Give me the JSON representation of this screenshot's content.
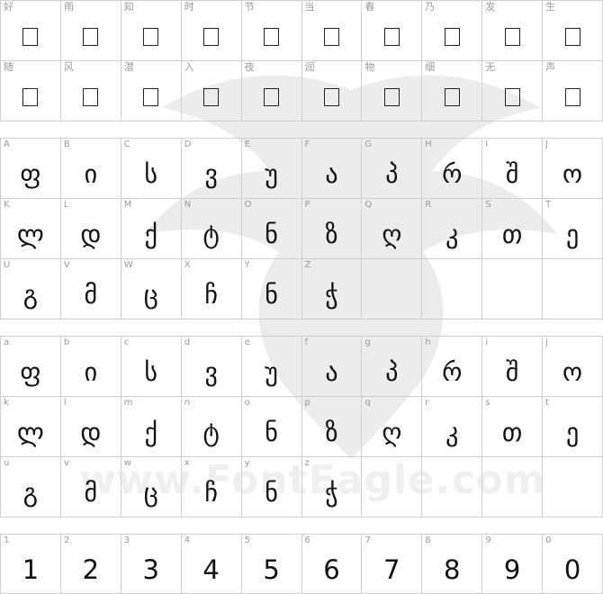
{
  "watermark": "www.FontEagle.com",
  "section1": {
    "labels": [
      "好",
      "雨",
      "知",
      "时",
      "节",
      "当",
      "春",
      "乃",
      "发",
      "生",
      "随",
      "风",
      "潜",
      "入",
      "夜",
      "润",
      "物",
      "细",
      "无",
      "声"
    ]
  },
  "section2": {
    "labels": [
      "A",
      "B",
      "C",
      "D",
      "E",
      "F",
      "G",
      "H",
      "I",
      "J",
      "K",
      "L",
      "M",
      "N",
      "O",
      "P",
      "Q",
      "R",
      "S",
      "T",
      "U",
      "V",
      "W",
      "X",
      "Y",
      "Z"
    ],
    "glyphs": [
      "ფ",
      "ი",
      "ს",
      "ვ",
      "უ",
      "ა",
      "პ",
      "რ",
      "შ",
      "ო",
      "ლ",
      "დ",
      "ქ",
      "ტ",
      "ნ",
      "ზ",
      "ღ",
      "კ",
      "თ",
      "ე",
      "გ",
      "მ",
      "ც",
      "ჩ",
      "ნ",
      "ჭ"
    ]
  },
  "section3": {
    "labels": [
      "a",
      "b",
      "c",
      "d",
      "e",
      "f",
      "g",
      "h",
      "i",
      "j",
      "k",
      "l",
      "m",
      "n",
      "o",
      "p",
      "q",
      "r",
      "s",
      "t",
      "u",
      "v",
      "w",
      "x",
      "y",
      "z"
    ],
    "glyphs": [
      "ფ",
      "ი",
      "ს",
      "ვ",
      "უ",
      "ა",
      "პ",
      "რ",
      "შ",
      "ო",
      "ლ",
      "დ",
      "ქ",
      "ტ",
      "ნ",
      "ზ",
      "ღ",
      "კ",
      "თ",
      "ე",
      "გ",
      "მ",
      "ც",
      "ჩ",
      "ნ",
      "ჭ"
    ]
  },
  "section4": {
    "labels": [
      "1",
      "2",
      "3",
      "4",
      "5",
      "6",
      "7",
      "8",
      "9",
      "0"
    ],
    "glyphs": [
      "1",
      "2",
      "3",
      "4",
      "5",
      "6",
      "7",
      "8",
      "9",
      "0"
    ]
  }
}
